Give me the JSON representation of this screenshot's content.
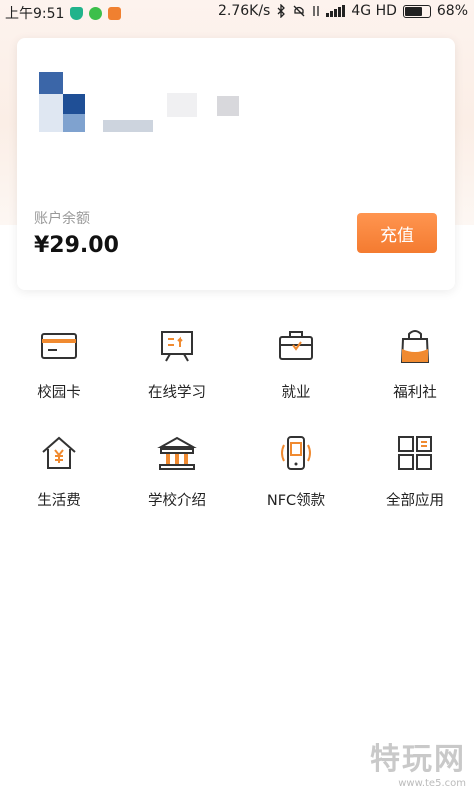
{
  "status_bar": {
    "time": "上午9:51",
    "speed": "2.76K/s",
    "network": "4G HD",
    "battery": "68%",
    "icons": [
      "shield-icon",
      "wechat-icon",
      "app-notification-icon",
      "bluetooth-icon",
      "silent-icon",
      "signal-icon",
      "battery-icon"
    ]
  },
  "card": {
    "balance_label": "账户余额",
    "balance_value": "¥29.00",
    "recharge_label": "充值"
  },
  "apps": [
    {
      "label": "校园卡",
      "icon": "card-icon"
    },
    {
      "label": "在线学习",
      "icon": "presentation-icon"
    },
    {
      "label": "就业",
      "icon": "briefcase-icon"
    },
    {
      "label": "福利社",
      "icon": "shopping-bag-icon"
    },
    {
      "label": "生活费",
      "icon": "house-yen-icon"
    },
    {
      "label": "学校介绍",
      "icon": "school-building-icon"
    },
    {
      "label": "NFC领款",
      "icon": "nfc-phone-icon"
    },
    {
      "label": "全部应用",
      "icon": "all-apps-icon"
    }
  ],
  "colors": {
    "accent": "#f47b30",
    "icon_stroke": "#333333"
  },
  "watermark": {
    "text": "特玩网",
    "sub": "www.te5.com"
  }
}
